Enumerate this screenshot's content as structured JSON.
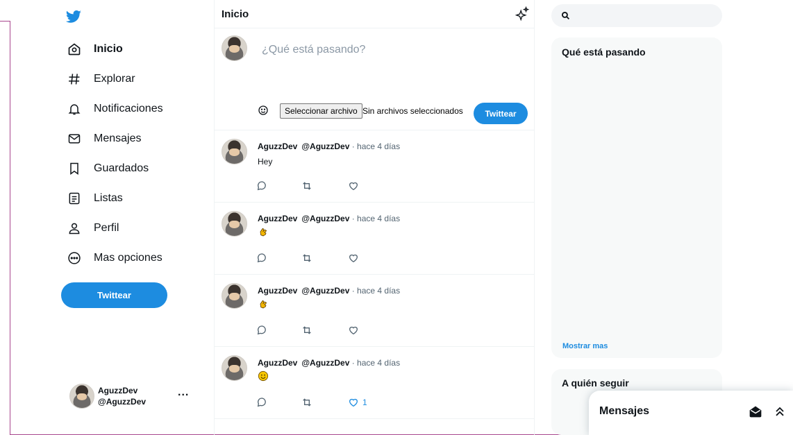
{
  "nav": {
    "items": [
      {
        "label": "Inicio",
        "icon": "home-icon"
      },
      {
        "label": "Explorar",
        "icon": "hashtag-icon"
      },
      {
        "label": "Notificaciones",
        "icon": "bell-icon"
      },
      {
        "label": "Mensajes",
        "icon": "envelope-icon"
      },
      {
        "label": "Guardados",
        "icon": "bookmark-icon"
      },
      {
        "label": "Listas",
        "icon": "list-icon"
      },
      {
        "label": "Perfil",
        "icon": "person-icon"
      },
      {
        "label": "Mas opciones",
        "icon": "more-circle-icon"
      }
    ],
    "tweet_button": "Twittear"
  },
  "profile": {
    "name": "AguzzDev",
    "handle": "@AguzzDev",
    "more": "..."
  },
  "header": {
    "title": "Inicio"
  },
  "composer": {
    "placeholder": "¿Qué está pasando?",
    "file_button": "Seleccionar archivo",
    "file_status": "Sin archivos seleccionados",
    "tweet_button": "Twittear"
  },
  "tweets": [
    {
      "name": "AguzzDev",
      "handle": "@AguzzDev",
      "time": " · hace 4 días",
      "text": "Hey",
      "emoji": null,
      "likes": ""
    },
    {
      "name": "AguzzDev",
      "handle": "@AguzzDev",
      "time": " · hace 4 días",
      "text": "",
      "emoji": "clap",
      "likes": ""
    },
    {
      "name": "AguzzDev",
      "handle": "@AguzzDev",
      "time": " · hace 4 días",
      "text": "",
      "emoji": "clap",
      "likes": ""
    },
    {
      "name": "AguzzDev",
      "handle": "@AguzzDev",
      "time": " · hace 4 días",
      "text": "",
      "emoji": "smile",
      "likes": "1"
    }
  ],
  "search": {
    "placeholder": ""
  },
  "trends": {
    "title": "Qué está pasando",
    "show_more": "Mostrar mas"
  },
  "who_to_follow": {
    "title": "A quién seguir"
  },
  "messages_drawer": {
    "title": "Mensajes"
  },
  "colors": {
    "accent": "#1d8ce0",
    "frame": "#a8458d"
  }
}
